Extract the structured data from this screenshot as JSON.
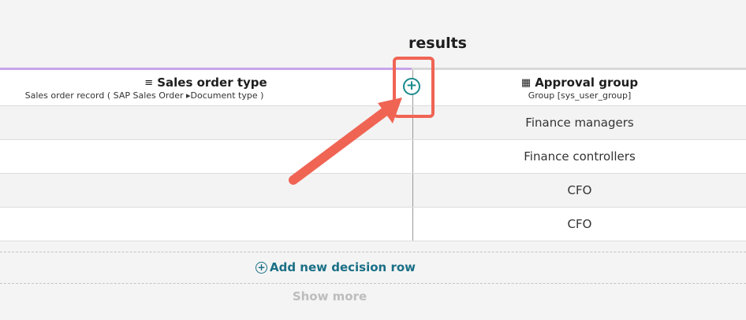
{
  "results_title": "results",
  "columns": {
    "sales_order_type": {
      "title": "Sales order type",
      "subtitle": "Sales order record ( SAP Sales Order ▸Document type )"
    },
    "approval_group": {
      "title": "Approval group",
      "subtitle": "Group [sys_user_group]"
    },
    "add_column_glyph": "+"
  },
  "rows": [
    {
      "approval_group": "Finance managers"
    },
    {
      "approval_group": "Finance controllers"
    },
    {
      "approval_group": "CFO"
    },
    {
      "approval_group": "CFO"
    }
  ],
  "add_row_label": "Add new decision row",
  "add_row_glyph": "+",
  "show_more_label": "Show more",
  "icons": {
    "sales_order_type": "text-lines-icon",
    "approval_group": "reference-table-icon"
  },
  "colors": {
    "accent_teal": "#1a8a8c",
    "annotation_red": "#f06454",
    "header_purple": "#c8a4e8"
  }
}
